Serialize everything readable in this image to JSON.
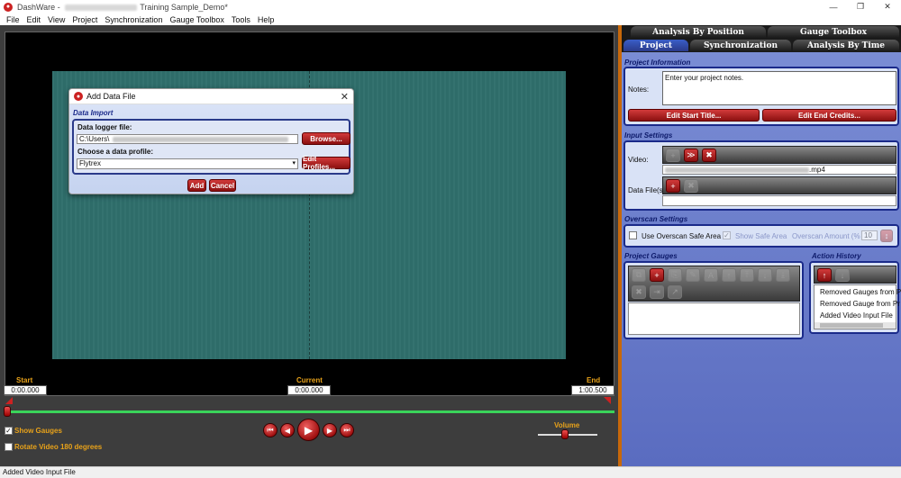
{
  "window": {
    "app_name": "DashWare",
    "title_suffix": "Training Sample_Demo*",
    "minimize": "—",
    "maximize": "❐",
    "close": "✕"
  },
  "menu": [
    "File",
    "Edit",
    "View",
    "Project",
    "Synchronization",
    "Gauge Toolbox",
    "Tools",
    "Help"
  ],
  "dialog": {
    "title": "Add Data File",
    "close": "✕",
    "section": "Data Import",
    "logger_label": "Data logger file:",
    "logger_value": "C:\\Users\\",
    "browse": "Browse...",
    "profile_label": "Choose a data profile:",
    "profile_value": "Flytrex",
    "edit_profiles": "Edit Profiles...",
    "add": "Add",
    "cancel": "Cancel"
  },
  "timeline": {
    "start_label": "Start",
    "start_value": "0:00.000",
    "current_label": "Current",
    "current_value": "0:00.000",
    "end_label": "End",
    "end_value": "1:00.500",
    "show_gauges": "Show Gauges",
    "show_gauges_checked": true,
    "rotate": "Rotate Video 180 degrees",
    "rotate_checked": false,
    "volume_label": "Volume",
    "volume_level": 0.45,
    "playhead_position": 0.0
  },
  "tabs": {
    "row1": [
      "Analysis By Position",
      "Gauge Toolbox"
    ],
    "row2": [
      "Project",
      "Synchronization",
      "Analysis By Time"
    ],
    "active": "Project"
  },
  "project_info": {
    "title": "Project Information",
    "notes_label": "Notes:",
    "notes_value": "Enter your project notes.",
    "edit_start": "Edit Start Title...",
    "edit_end": "Edit End Credits..."
  },
  "input_settings": {
    "title": "Input Settings",
    "video_label": "Video:",
    "video_file_suffix": ".mp4",
    "data_files_label": "Data File(s):"
  },
  "overscan": {
    "title": "Overscan Settings",
    "use_label": "Use Overscan Safe Area",
    "show_safe": "Show Safe Area",
    "amount_label": "Overscan Amount (%",
    "amount_value": "10"
  },
  "gauges": {
    "title": "Project Gauges"
  },
  "history": {
    "title": "Action History",
    "items": [
      "Removed Gauges from P",
      "Removed Gauge from Pr",
      "Added Video Input File"
    ]
  },
  "status": "Added Video Input File",
  "colors": {
    "accent_orange": "#e8a21a",
    "button_red": "#b22222",
    "panel_blue": "#6a7ccc",
    "video_teal": "#2f6f6c",
    "track_green": "#3ad45a"
  }
}
